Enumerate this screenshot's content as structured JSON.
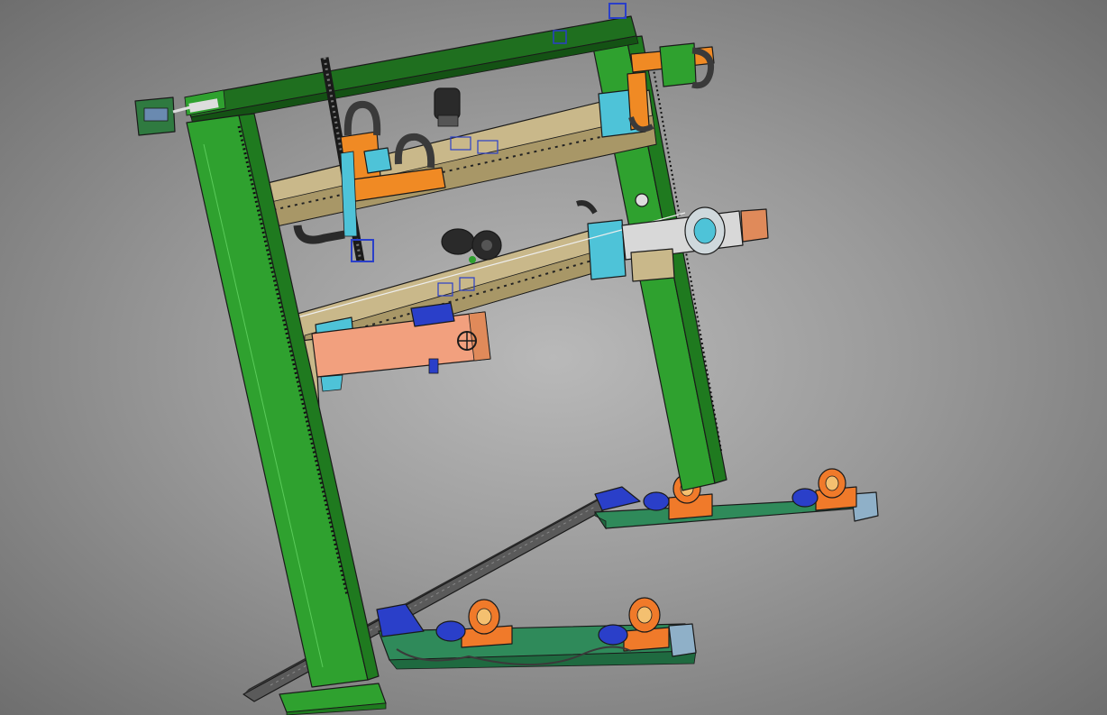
{
  "scene": {
    "palette": {
      "frame_green": "#2fa12f",
      "frame_green_dark": "#1f7a1f",
      "top_beam": "#1f6f1f",
      "rail_tan": "#c9b88a",
      "rail_tan_dark": "#a89767",
      "carriage_orange": "#f08a24",
      "carriage_cyan": "#4ec3d8",
      "arm_salmon": "#f2a07e",
      "roller_orange": "#f07a2a",
      "base_teal": "#2f8a5a",
      "motor_blue": "#2a3fc9",
      "cable_black": "#2a2a2a",
      "linear_guide": "#3a3a3a"
    },
    "components": [
      "left-column",
      "right-column",
      "top-beam",
      "upper-gantry-rail",
      "lower-gantry-rail",
      "upper-carriage",
      "right-carriage",
      "welding-arm",
      "rotary-head",
      "front-roller-base",
      "rear-roller-base",
      "floor-track",
      "drive-motor"
    ]
  }
}
